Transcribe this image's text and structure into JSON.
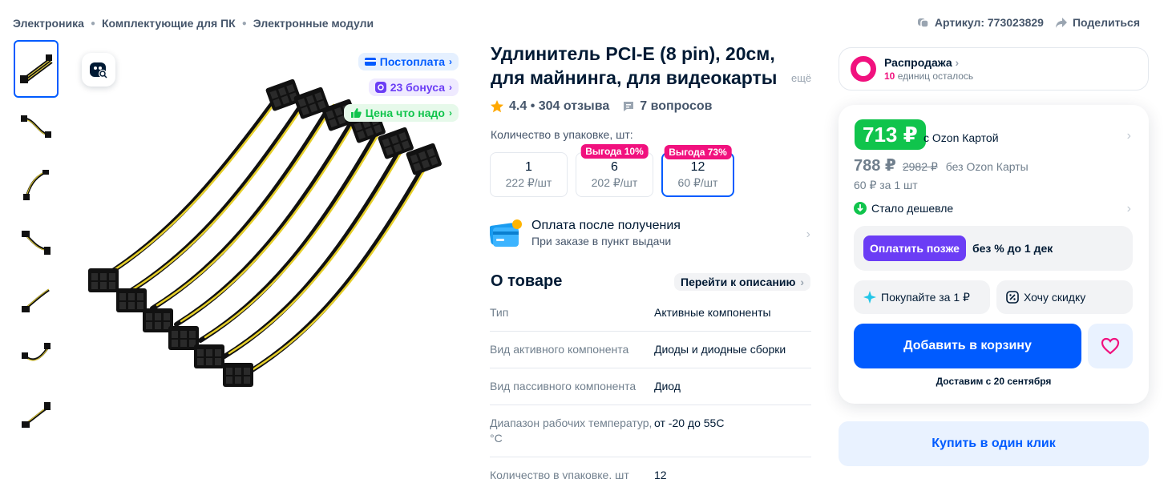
{
  "breadcrumb": [
    "Электроника",
    "Комплектующие для ПК",
    "Электронные модули"
  ],
  "header": {
    "article": "Артикул: 773023829",
    "share": "Поделиться"
  },
  "tags": {
    "postpay": "Постоплата",
    "bonus": "23 бонуса",
    "good_price": "Цена что надо"
  },
  "product": {
    "title": "Удлинитель PCI-E (8 pin), 20см, для майнинга, для видеокарты",
    "more": "ещё",
    "rating": "4.4 • 304 отзыва",
    "questions": "7 вопросов"
  },
  "quantity": {
    "label": "Количество в упаковке, шт:",
    "options": [
      {
        "num": "1",
        "price": "222 ₽/шт",
        "badge": ""
      },
      {
        "num": "6",
        "price": "202 ₽/шт",
        "badge": "Выгода 10%"
      },
      {
        "num": "12",
        "price": "60 ₽/шт",
        "badge": "Выгода 73%"
      }
    ]
  },
  "payment": {
    "title": "Оплата после получения",
    "subtitle": "При заказе в пункт выдачи"
  },
  "about": {
    "title": "О товаре",
    "goto": "Перейти к описанию",
    "specs": [
      {
        "k": "Тип",
        "v": "Активные компоненты"
      },
      {
        "k": "Вид активного компонента",
        "v": "Диоды и диодные сборки"
      },
      {
        "k": "Вид пассивного компонента",
        "v": "Диод"
      },
      {
        "k": "Диапазон рабочих температур, °C",
        "v": "от -20 до 55С"
      },
      {
        "k": "Количество в упаковке, шт",
        "v": "12"
      }
    ]
  },
  "sale": {
    "title": "Распродажа",
    "left_count": "10",
    "left_text": "единиц осталось"
  },
  "price": {
    "card_price": "713 ₽",
    "card_label": "с Ozon Картой",
    "regular": "788 ₽",
    "old": "2982 ₽",
    "regular_label": "без Ozon Карты",
    "unit": "60 ₽ за 1 шт",
    "cheaper": "Стало дешевле"
  },
  "paylater": {
    "button": "Оплатить позже",
    "text": "без % до 1 дек"
  },
  "buttons": {
    "buy_for_1": "Покупайте за 1 ₽",
    "want_discount": "Хочу скидку",
    "add_to_cart": "Добавить в корзину",
    "delivery": "Доставим с 20 сентября",
    "one_click": "Купить в один клик"
  },
  "colors": {
    "accent": "#005bff",
    "green": "#10c44c",
    "pink": "#f1117e",
    "purple": "#6b3df5"
  }
}
